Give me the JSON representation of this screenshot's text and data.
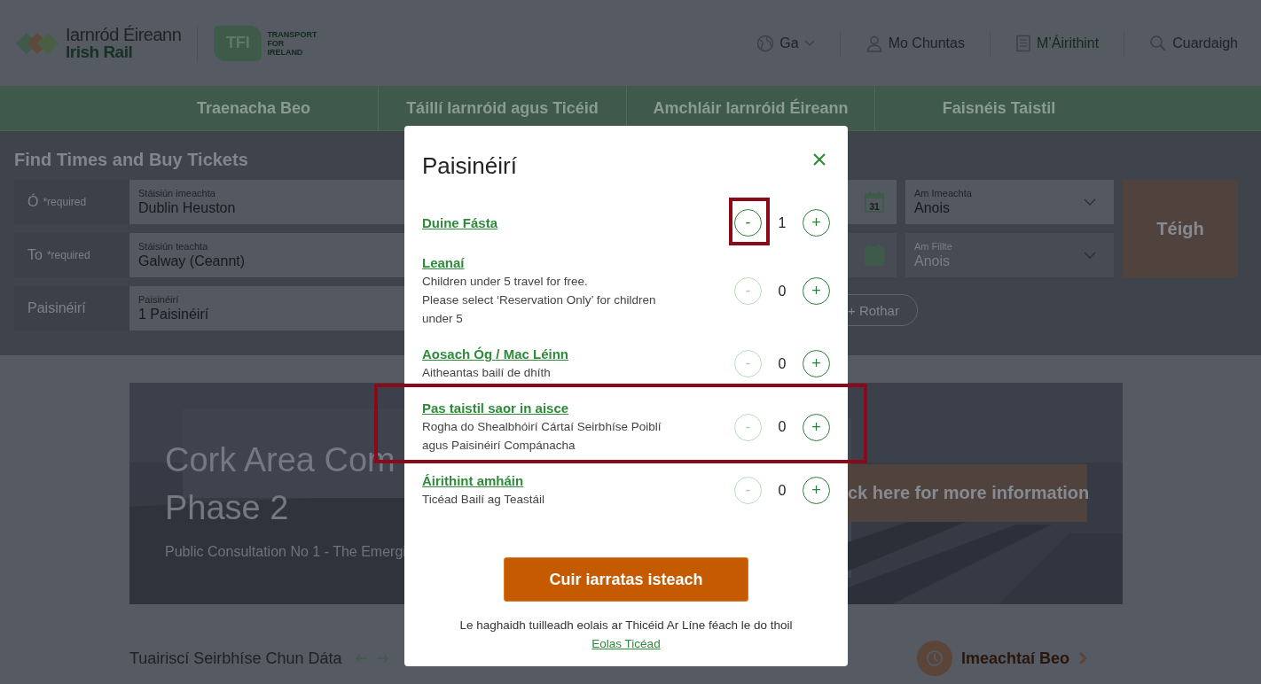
{
  "header": {
    "logo": {
      "name_ga": "Iarnród Éireann",
      "name_en": "Irish Rail"
    },
    "tfi": {
      "mark": "TFI",
      "lines": [
        "TRANSPORT",
        "FOR",
        "IRELAND"
      ]
    },
    "utility": [
      {
        "kind": "language",
        "label": "Ga"
      },
      {
        "kind": "account",
        "label": "Mo Chuntas"
      },
      {
        "kind": "bookings",
        "label": "M’Áirithint"
      },
      {
        "kind": "search",
        "label": "Cuardaigh"
      }
    ]
  },
  "nav": [
    "Traenacha Beo",
    "Táillí Iarnróid agus Ticéid",
    "Amchláir Iarnróid Éireann",
    "Faisnéis Taistil"
  ],
  "search": {
    "title": "Find Times and Buy Tickets",
    "rows": [
      {
        "label": "Ó",
        "required": "*required",
        "field_label": "Stáisiún imeachta",
        "value": "Dublin Heuston",
        "date_disabled": false,
        "time_label": "Am Imeachta",
        "time_value": "Anois",
        "time_disabled": false
      },
      {
        "label": "To",
        "required": "*required",
        "field_label": "Stáisiún teachta",
        "value": "Galway (Ceannt)",
        "date_disabled": true,
        "time_label": "Am Fillte",
        "time_value": "Anois",
        "time_disabled": true
      }
    ],
    "passengers": {
      "label": "Paisinéirí",
      "field_label": "Paisinéirí",
      "value": "1 Paisinéirí"
    },
    "bike_button": "+ Rothar",
    "go_button": "Téigh",
    "calendar_day": "31"
  },
  "banner": {
    "title_lines": [
      "Cork Area Com",
      "Phase 2"
    ],
    "subtitle": "Public Consultation No 1 - The Emergi",
    "button": "ck here for more information"
  },
  "bottom": {
    "heading": "Tuairiscí Seirbhíse Chun Dáta",
    "live": "Imeachtaí Beo"
  },
  "modal": {
    "title": "Paisinéirí",
    "rows": [
      {
        "name": "Duine Fásta",
        "desc": [],
        "count": "1",
        "minus_disabled": false,
        "highlighted": true
      },
      {
        "name": "Leanaí",
        "desc": [
          "Children under 5 travel for free.",
          "Please select ‘Reservation Only’ for children under 5"
        ],
        "count": "0",
        "minus_disabled": true,
        "highlighted": false
      },
      {
        "name": "Aosach Óg / Mac Léinn",
        "desc": [
          "Aitheantas bailí de dhíth"
        ],
        "count": "0",
        "minus_disabled": true,
        "highlighted": false
      },
      {
        "name": "Pas taistil saor in aisce",
        "desc": [
          "Rogha do Shealbhóirí Cártaí Seirbhíse Poiblí agus Paisinéirí Compánacha"
        ],
        "count": "0",
        "minus_disabled": true,
        "highlighted": true
      },
      {
        "name": "Áirithint amháin",
        "desc": [
          "Ticéad Bailí ag Teastáil"
        ],
        "count": "0",
        "minus_disabled": true,
        "highlighted": false
      }
    ],
    "minus": "-",
    "plus": "+",
    "submit": "Cuir iarratas isteach",
    "note": "Le haghaidh tuilleadh eolais ar Thicéid Ar Líne féach le do thoil",
    "note_link": "Eolas Ticéad"
  }
}
